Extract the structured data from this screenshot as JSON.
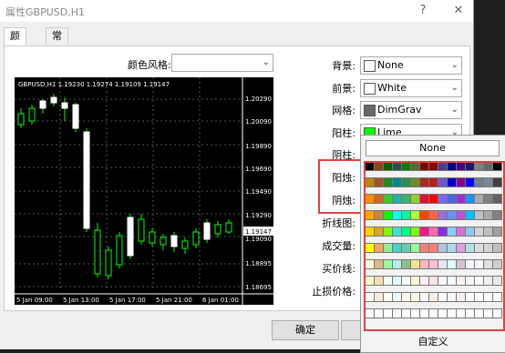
{
  "window": {
    "title": "属性GBPUSD,H1",
    "help": "?",
    "close": "✕"
  },
  "tabs": [
    {
      "label": "颜色"
    },
    {
      "label": "常用"
    }
  ],
  "color_scheme": {
    "label": "颜色风格:",
    "value": ""
  },
  "chart": {
    "header": "GBPUSD,H1  1.19230 1.19274 1.19109 1.19147",
    "price_labels": [
      "1.20290",
      "1.20090",
      "1.19890",
      "1.19690",
      "1.19490",
      "1.19290",
      "1.19147",
      "1.19090",
      "1.18895",
      "1.18695"
    ],
    "time_labels": [
      "5 Jan 09:00",
      "5 Jan 13:00",
      "5 Jan 17:00",
      "5 Jan 21:00",
      "6 Jan 01:00"
    ]
  },
  "props": [
    {
      "label": "背景:",
      "value": "None",
      "color": "#ffffff"
    },
    {
      "label": "前景:",
      "value": "White",
      "color": "#ffffff"
    },
    {
      "label": "网格:",
      "value": "DimGrav",
      "color": "#696969"
    },
    {
      "label": "阳柱:",
      "value": "Lime",
      "color": "#00ff00"
    },
    {
      "label": "阴柱:"
    },
    {
      "label": "阳烛:"
    },
    {
      "label": "阴烛:"
    },
    {
      "label": "折线图:"
    },
    {
      "label": "成交量:"
    },
    {
      "label": "买价线:"
    },
    {
      "label": "止损价格:"
    }
  ],
  "buttons": {
    "ok": "确定"
  },
  "popup": {
    "none_label": "None",
    "custom_label": "自定义",
    "rows": [
      [
        "#000000",
        "#8b4513",
        "#006400",
        "#2f4f4f",
        "#008000",
        "#556b2f",
        "#800000",
        "#8b0000",
        "#483d8b",
        "#000080",
        "#4b0082",
        "#191970",
        "#808080",
        "#696969",
        "#000000"
      ],
      [
        "#b8860b",
        "#a0522d",
        "#228b22",
        "#008b8b",
        "#2e8b57",
        "#6b8e23",
        "#a52a2a",
        "#b22222",
        "#6a5acd",
        "#0000cd",
        "#8b008b",
        "#0000ff",
        "#708090",
        "#778899",
        "#404040"
      ],
      [
        "#ff8c00",
        "#d2691e",
        "#32cd32",
        "#20b2aa",
        "#3cb371",
        "#9acd32",
        "#dc143c",
        "#ff0000",
        "#7b68ee",
        "#4169e1",
        "#9932cc",
        "#1e90ff",
        "#a9a9a9",
        "#808080",
        "#606060"
      ],
      [
        "#ffa500",
        "#cd853f",
        "#00ff00",
        "#00ffff",
        "#00fa9a",
        "#adff2f",
        "#ff4500",
        "#ff6347",
        "#9370db",
        "#6495ed",
        "#ba55d3",
        "#00bfff",
        "#c0c0c0",
        "#a9a9a9",
        "#808080"
      ],
      [
        "#ffd700",
        "#daa520",
        "#7cfc00",
        "#40e0d0",
        "#00ff7f",
        "#7fff00",
        "#ff1493",
        "#ff69b4",
        "#8a2be2",
        "#87cefa",
        "#da70d6",
        "#87ceeb",
        "#d3d3d3",
        "#c0c0c0",
        "#a0a0a0"
      ],
      [
        "#ffff00",
        "#f4a460",
        "#90ee90",
        "#48d1cc",
        "#66cdaa",
        "#98fb98",
        "#f08080",
        "#fa8072",
        "#b0c4de",
        "#add8e6",
        "#dda0dd",
        "#b0e0e6",
        "#dcdcdc",
        "#d3d3d3",
        "#c0c0c0"
      ],
      [
        "#ffffe0",
        "#deb887",
        "#98fb98",
        "#afeeee",
        "#8fbc8f",
        "#f0e68c",
        "#ffb6c1",
        "#ffc0cb",
        "#e6e6fa",
        "#e0ffff",
        "#d8bfd8",
        "#f0f8ff",
        "#f5f5f5",
        "#e0e0e0",
        "#d0d0d0"
      ],
      [
        "#fffacd",
        "#f5deb3",
        "#f0fff0",
        "#e0ffff",
        "#f5fffa",
        "#fafad2",
        "#fff0f5",
        "#ffe4e1",
        "#f8f8ff",
        "#f0ffff",
        "#fff5ee",
        "#f5f5f5",
        "#ffffff",
        "#f0f0f0",
        "#e8e8e8"
      ],
      [
        "#ffffff",
        "#faebd7",
        "#fffff0",
        "#f0ffff",
        "#fffaf0",
        "#fdf5e6",
        "#fffafa",
        "#faf0e6",
        "#ffffff",
        "#f8f8ff",
        "#fff0f5",
        "#ffffff",
        "#ffffff",
        "#ffffff",
        "#ffffff"
      ],
      [
        "#ffffff",
        "#ffffff",
        "#ffffff",
        "#ffffff",
        "#ffffff",
        "#ffffff",
        "#ffffff",
        "#ffffff",
        "#ffffff",
        "#ffffff",
        "#ffffff",
        "#ffffff",
        "#ffffff",
        "#ffffff",
        "#ffffff"
      ]
    ]
  }
}
